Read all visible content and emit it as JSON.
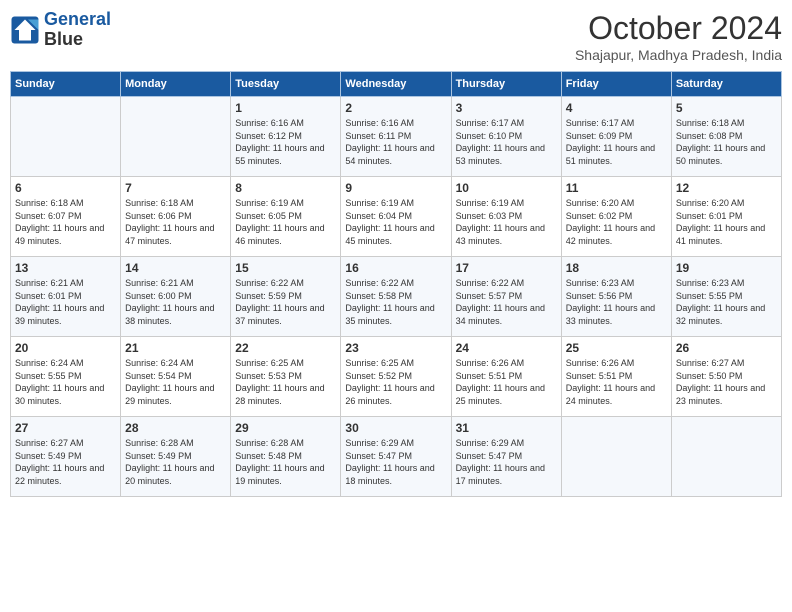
{
  "header": {
    "logo_line1": "General",
    "logo_line2": "Blue",
    "month_year": "October 2024",
    "location": "Shajapur, Madhya Pradesh, India"
  },
  "weekdays": [
    "Sunday",
    "Monday",
    "Tuesday",
    "Wednesday",
    "Thursday",
    "Friday",
    "Saturday"
  ],
  "weeks": [
    [
      {
        "day": "",
        "info": ""
      },
      {
        "day": "",
        "info": ""
      },
      {
        "day": "1",
        "info": "Sunrise: 6:16 AM\nSunset: 6:12 PM\nDaylight: 11 hours and 55 minutes."
      },
      {
        "day": "2",
        "info": "Sunrise: 6:16 AM\nSunset: 6:11 PM\nDaylight: 11 hours and 54 minutes."
      },
      {
        "day": "3",
        "info": "Sunrise: 6:17 AM\nSunset: 6:10 PM\nDaylight: 11 hours and 53 minutes."
      },
      {
        "day": "4",
        "info": "Sunrise: 6:17 AM\nSunset: 6:09 PM\nDaylight: 11 hours and 51 minutes."
      },
      {
        "day": "5",
        "info": "Sunrise: 6:18 AM\nSunset: 6:08 PM\nDaylight: 11 hours and 50 minutes."
      }
    ],
    [
      {
        "day": "6",
        "info": "Sunrise: 6:18 AM\nSunset: 6:07 PM\nDaylight: 11 hours and 49 minutes."
      },
      {
        "day": "7",
        "info": "Sunrise: 6:18 AM\nSunset: 6:06 PM\nDaylight: 11 hours and 47 minutes."
      },
      {
        "day": "8",
        "info": "Sunrise: 6:19 AM\nSunset: 6:05 PM\nDaylight: 11 hours and 46 minutes."
      },
      {
        "day": "9",
        "info": "Sunrise: 6:19 AM\nSunset: 6:04 PM\nDaylight: 11 hours and 45 minutes."
      },
      {
        "day": "10",
        "info": "Sunrise: 6:19 AM\nSunset: 6:03 PM\nDaylight: 11 hours and 43 minutes."
      },
      {
        "day": "11",
        "info": "Sunrise: 6:20 AM\nSunset: 6:02 PM\nDaylight: 11 hours and 42 minutes."
      },
      {
        "day": "12",
        "info": "Sunrise: 6:20 AM\nSunset: 6:01 PM\nDaylight: 11 hours and 41 minutes."
      }
    ],
    [
      {
        "day": "13",
        "info": "Sunrise: 6:21 AM\nSunset: 6:01 PM\nDaylight: 11 hours and 39 minutes."
      },
      {
        "day": "14",
        "info": "Sunrise: 6:21 AM\nSunset: 6:00 PM\nDaylight: 11 hours and 38 minutes."
      },
      {
        "day": "15",
        "info": "Sunrise: 6:22 AM\nSunset: 5:59 PM\nDaylight: 11 hours and 37 minutes."
      },
      {
        "day": "16",
        "info": "Sunrise: 6:22 AM\nSunset: 5:58 PM\nDaylight: 11 hours and 35 minutes."
      },
      {
        "day": "17",
        "info": "Sunrise: 6:22 AM\nSunset: 5:57 PM\nDaylight: 11 hours and 34 minutes."
      },
      {
        "day": "18",
        "info": "Sunrise: 6:23 AM\nSunset: 5:56 PM\nDaylight: 11 hours and 33 minutes."
      },
      {
        "day": "19",
        "info": "Sunrise: 6:23 AM\nSunset: 5:55 PM\nDaylight: 11 hours and 32 minutes."
      }
    ],
    [
      {
        "day": "20",
        "info": "Sunrise: 6:24 AM\nSunset: 5:55 PM\nDaylight: 11 hours and 30 minutes."
      },
      {
        "day": "21",
        "info": "Sunrise: 6:24 AM\nSunset: 5:54 PM\nDaylight: 11 hours and 29 minutes."
      },
      {
        "day": "22",
        "info": "Sunrise: 6:25 AM\nSunset: 5:53 PM\nDaylight: 11 hours and 28 minutes."
      },
      {
        "day": "23",
        "info": "Sunrise: 6:25 AM\nSunset: 5:52 PM\nDaylight: 11 hours and 26 minutes."
      },
      {
        "day": "24",
        "info": "Sunrise: 6:26 AM\nSunset: 5:51 PM\nDaylight: 11 hours and 25 minutes."
      },
      {
        "day": "25",
        "info": "Sunrise: 6:26 AM\nSunset: 5:51 PM\nDaylight: 11 hours and 24 minutes."
      },
      {
        "day": "26",
        "info": "Sunrise: 6:27 AM\nSunset: 5:50 PM\nDaylight: 11 hours and 23 minutes."
      }
    ],
    [
      {
        "day": "27",
        "info": "Sunrise: 6:27 AM\nSunset: 5:49 PM\nDaylight: 11 hours and 22 minutes."
      },
      {
        "day": "28",
        "info": "Sunrise: 6:28 AM\nSunset: 5:49 PM\nDaylight: 11 hours and 20 minutes."
      },
      {
        "day": "29",
        "info": "Sunrise: 6:28 AM\nSunset: 5:48 PM\nDaylight: 11 hours and 19 minutes."
      },
      {
        "day": "30",
        "info": "Sunrise: 6:29 AM\nSunset: 5:47 PM\nDaylight: 11 hours and 18 minutes."
      },
      {
        "day": "31",
        "info": "Sunrise: 6:29 AM\nSunset: 5:47 PM\nDaylight: 11 hours and 17 minutes."
      },
      {
        "day": "",
        "info": ""
      },
      {
        "day": "",
        "info": ""
      }
    ]
  ]
}
